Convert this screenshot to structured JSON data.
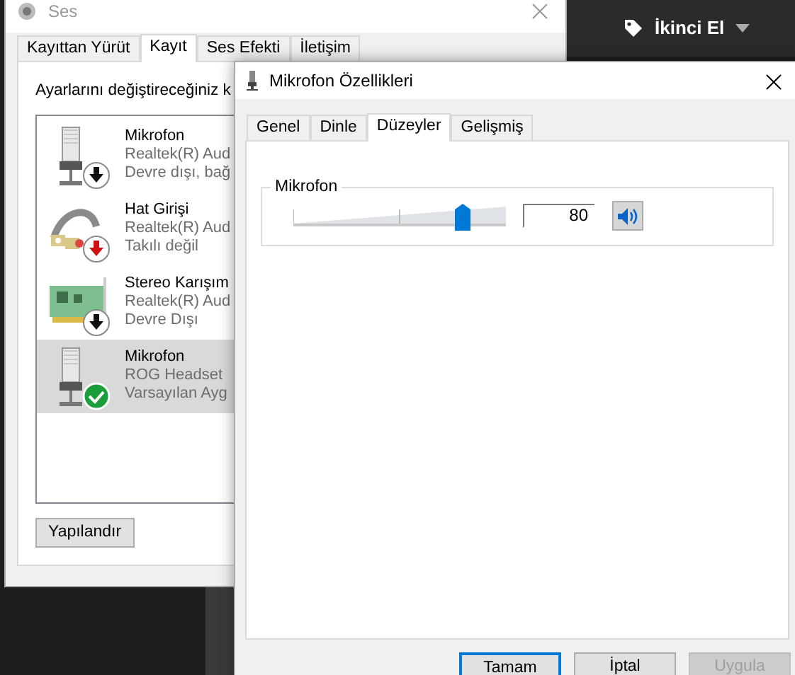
{
  "background_window": {
    "title": "Ses",
    "tabs": [
      {
        "label": "Kayıttan Yürüt",
        "selected": false
      },
      {
        "label": "Kayıt",
        "selected": true
      },
      {
        "label": "Ses Efekti",
        "selected": false
      },
      {
        "label": "İletişim",
        "selected": false
      }
    ],
    "instruction": "Ayarlarını değiştireceğiniz k",
    "devices": [
      {
        "name": "Mikrofon",
        "driver": "Realtek(R) Aud",
        "state": "Devre dışı, bağ",
        "kind": "microphone",
        "is_default": false,
        "plugged_in": true,
        "selected": false
      },
      {
        "name": "Hat Girişi",
        "driver": "Realtek(R) Aud",
        "state": "Takılı değil",
        "kind": "cable",
        "is_default": false,
        "plugged_in": false,
        "selected": false
      },
      {
        "name": "Stereo Karışım",
        "driver": "Realtek(R) Aud",
        "state": "Devre Dışı",
        "kind": "card",
        "is_default": false,
        "plugged_in": true,
        "selected": false
      },
      {
        "name": "Mikrofon",
        "driver": "ROG Headset",
        "state": "Varsayılan Ayg",
        "kind": "microphone",
        "is_default": true,
        "selected": true
      }
    ],
    "configure_button": "Yapılandır"
  },
  "dialog": {
    "title": "Mikrofon Özellikleri",
    "tabs": [
      {
        "label": "Genel",
        "selected": false
      },
      {
        "label": "Dinle",
        "selected": false
      },
      {
        "label": "Düzeyler",
        "selected": true
      },
      {
        "label": "Gelişmiş",
        "selected": false
      }
    ],
    "group_label": "Mikrofon",
    "slider": {
      "level": 0.8
    },
    "value": "80",
    "muted": false,
    "buttons": [
      {
        "label": "Tamam",
        "kind": "default",
        "disabled": false
      },
      {
        "label": "İptal",
        "kind": "normal",
        "disabled": false
      },
      {
        "label": "Uygula",
        "kind": "normal",
        "disabled": true
      }
    ]
  },
  "top_bar": {
    "label": "İkinci El"
  }
}
